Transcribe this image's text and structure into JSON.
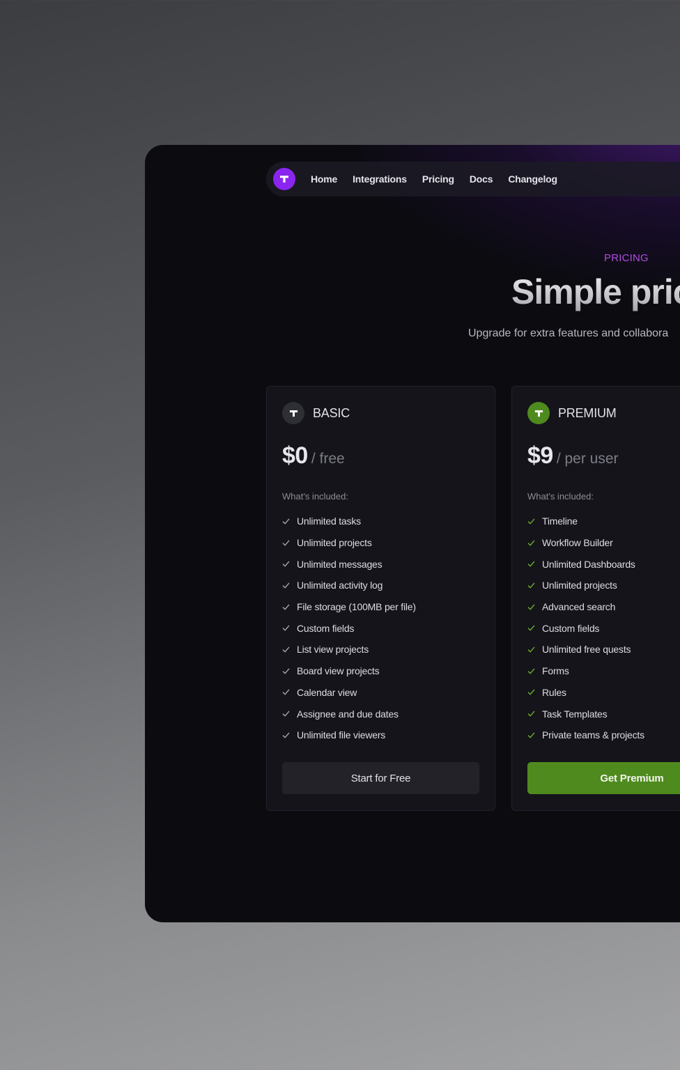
{
  "nav": {
    "logo_icon": "t-logo-icon",
    "links": [
      "Home",
      "Integrations",
      "Pricing",
      "Docs",
      "Changelog"
    ]
  },
  "hero": {
    "eyebrow": "PRICING",
    "headline": "Simple pric",
    "subline": "Upgrade for extra features and collabora"
  },
  "plans": {
    "basic": {
      "name": "BASIC",
      "price": "$0",
      "unit": "/ free",
      "included_label": "What's included:",
      "features": [
        "Unlimited tasks",
        "Unlimited projects",
        "Unlimited messages",
        "Unlimited activity log",
        "File storage (100MB per file)",
        "Custom fields",
        "List view projects",
        "Board view projects",
        "Calendar view",
        "Assignee and due dates",
        "Unlimited file viewers"
      ],
      "cta": "Start for Free",
      "icon_color": "#2e2e35",
      "check_color": "#a8a8b2"
    },
    "premium": {
      "name": "PREMIUM",
      "price": "$9",
      "unit": "/ per user",
      "included_label": "What's included:",
      "features": [
        "Timeline",
        "Workflow Builder",
        "Unlimited Dashboards",
        "Unlimited projects",
        "Advanced search",
        "Custom fields",
        "Unlimited free quests",
        "Forms",
        "Rules",
        "Task Templates",
        "Private teams & projects"
      ],
      "cta": "Get Premium",
      "icon_color": "#4f8a1e",
      "check_color": "#6fae2e"
    }
  },
  "colors": {
    "brand_purple": "#8a25f0",
    "accent_green": "#4f8a1e",
    "eyebrow": "#b04ce0"
  }
}
